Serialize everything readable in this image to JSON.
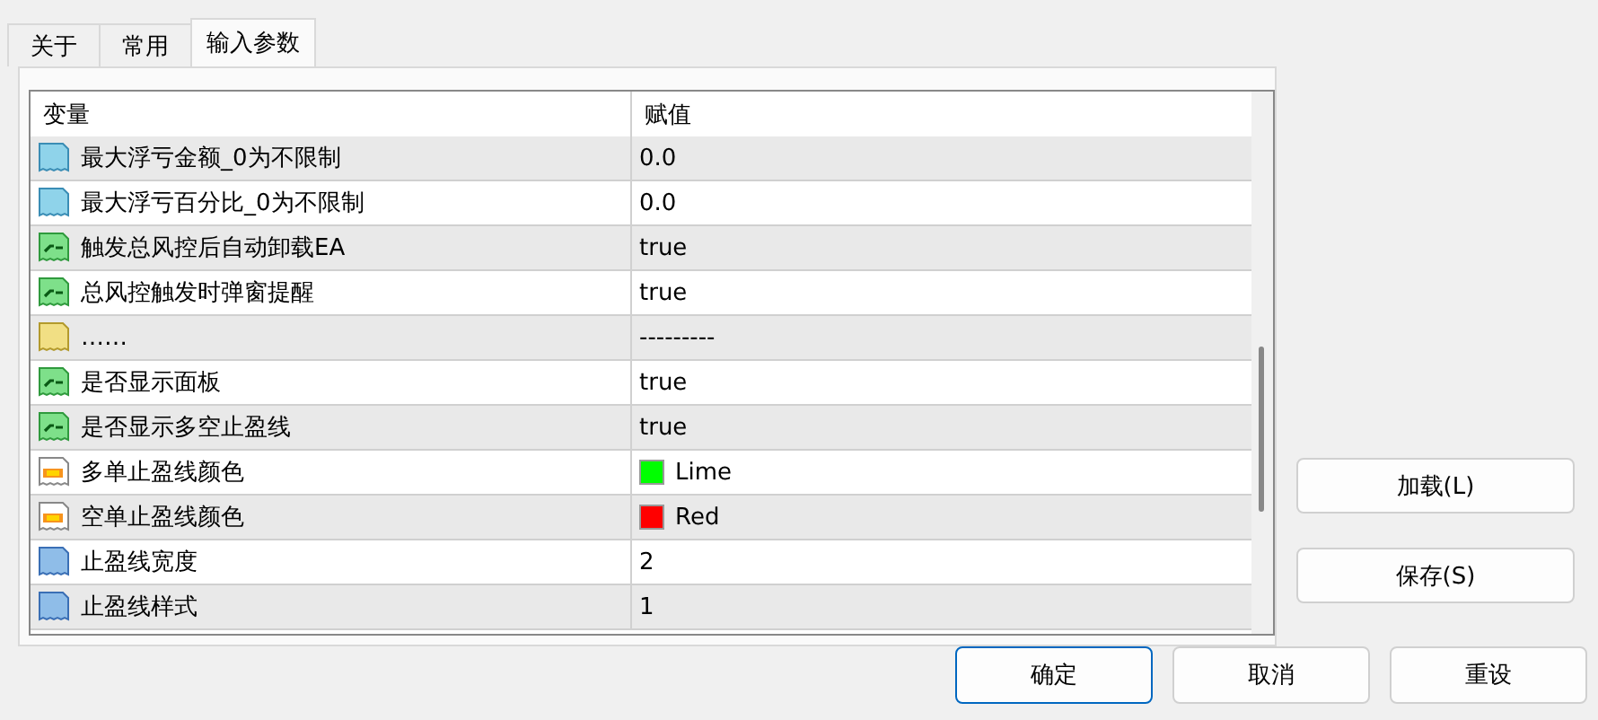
{
  "tabs": [
    {
      "label": "关于",
      "selected": false
    },
    {
      "label": "常用",
      "selected": false
    },
    {
      "label": "输入参数",
      "selected": true
    }
  ],
  "table": {
    "columns": [
      "变量",
      "赋值"
    ],
    "rows": [
      {
        "kind": "double",
        "name": "最大浮亏金额_0为不限制",
        "value": "0.0"
      },
      {
        "kind": "double",
        "name": "最大浮亏百分比_0为不限制",
        "value": "0.0"
      },
      {
        "kind": "bool",
        "name": "触发总风控后自动卸载EA",
        "value": "true"
      },
      {
        "kind": "bool",
        "name": "总风控触发时弹窗提醒",
        "value": "true"
      },
      {
        "kind": "string",
        "name": "……",
        "value": "---------"
      },
      {
        "kind": "bool",
        "name": "是否显示面板",
        "value": "true"
      },
      {
        "kind": "bool",
        "name": "是否显示多空止盈线",
        "value": "true"
      },
      {
        "kind": "color",
        "name": "多单止盈线颜色",
        "value": "Lime",
        "color": "#00ff00"
      },
      {
        "kind": "color",
        "name": "空单止盈线颜色",
        "value": "Red",
        "color": "#ff0000"
      },
      {
        "kind": "int",
        "name": "止盈线宽度",
        "value": "2"
      },
      {
        "kind": "int",
        "name": "止盈线样式",
        "value": "1"
      }
    ]
  },
  "side_buttons": [
    "加载(L)",
    "保存(S)"
  ],
  "buttons": [
    {
      "label": "确定",
      "default": true
    },
    {
      "label": "取消",
      "default": false
    },
    {
      "label": "重设",
      "default": false
    }
  ]
}
